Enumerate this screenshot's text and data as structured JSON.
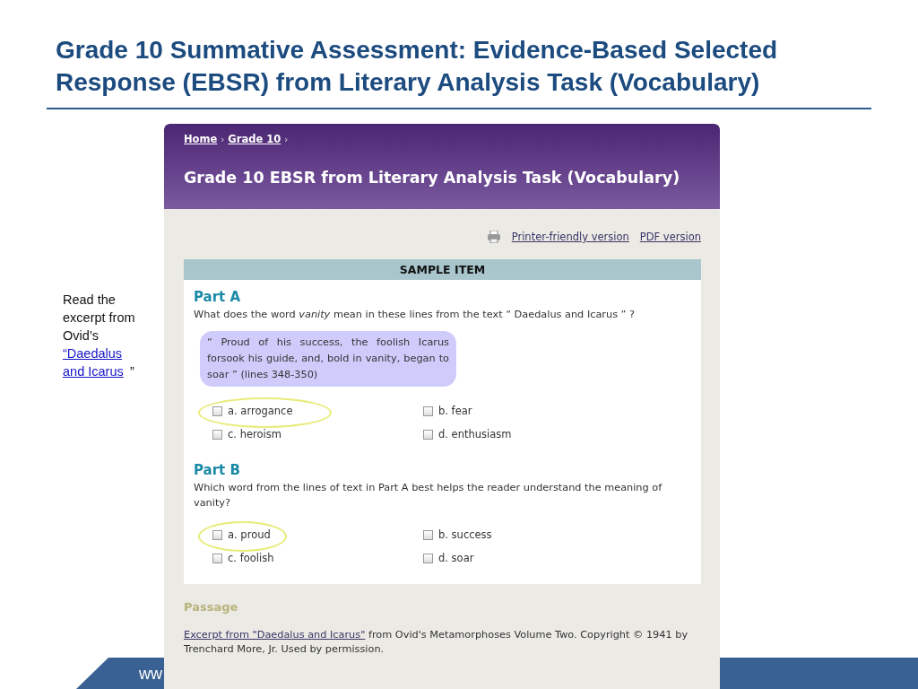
{
  "slide_title": "Grade 10 Summative Assessment: Evidence-Based Selected Response (EBSR) from Literary Analysis Task (Vocabulary)",
  "side_note": {
    "text": "Read the excerpt from Ovid’s",
    "link": "“Daedalus and Icarus",
    "after": "”"
  },
  "page": {
    "breadcrumb": [
      "Home",
      "Grade 10"
    ],
    "separator": "›",
    "title": "Grade 10 EBSR from Literary Analysis Task (Vocabulary)",
    "actions": [
      "Printer-friendly version",
      "PDF version"
    ],
    "sample_header": "SAMPLE ITEM",
    "parts": [
      {
        "heading": "Part A",
        "question": "What does the word *vanity* mean in these lines from the text “ Daedalus and Icarus ” ?",
        "quote": "“ Proud of his success, the foolish Icarus forsook his guide, and, bold in vanity, began to soar ” (lines 348-350)",
        "options": [
          {
            "label": "a. arrogance",
            "checked": false,
            "highlighted": true
          },
          {
            "label": "b. fear",
            "checked": false,
            "highlighted": false
          },
          {
            "label": "c. heroism",
            "checked": false,
            "highlighted": false
          },
          {
            "label": "d. enthusiasm",
            "checked": false,
            "highlighted": false
          }
        ]
      },
      {
        "heading": "Part B",
        "question": "Which word from the lines of text in Part A best helps the reader understand the meaning of vanity?",
        "options": [
          {
            "label": "a. proud",
            "checked": false,
            "highlighted": true
          },
          {
            "label": "b. success",
            "checked": false,
            "highlighted": false
          },
          {
            "label": "c. foolish",
            "checked": false,
            "highlighted": false
          },
          {
            "label": "d. soar",
            "checked": false,
            "highlighted": false
          }
        ]
      }
    ],
    "passage": {
      "heading": "Passage",
      "link": "Excerpt from \"Daedalus and Icarus\"",
      "text": " from Ovid's Metamorphoses Volume Two. Copyright © 1941 by Trenchard More, Jr. Used by permission."
    }
  },
  "footer_text": "ww"
}
